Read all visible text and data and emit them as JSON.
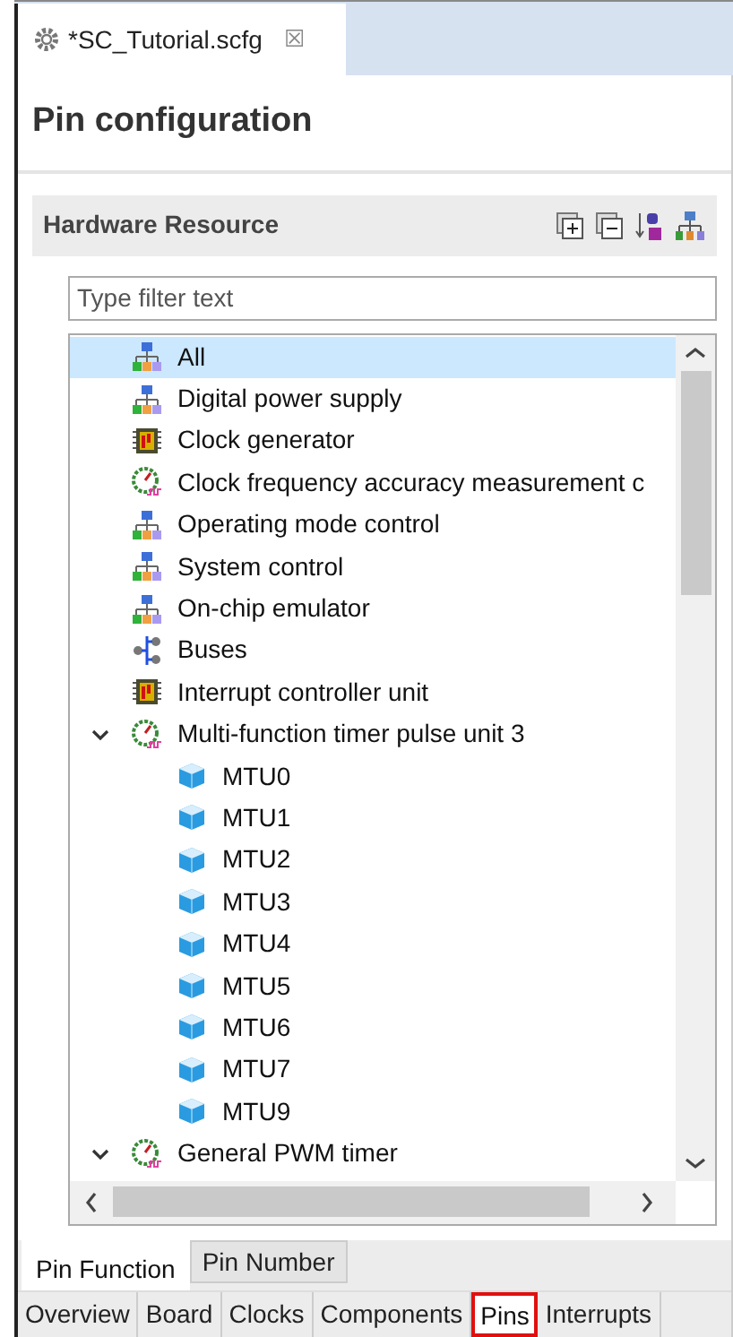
{
  "editor_tab": {
    "title": "*SC_Tutorial.scfg",
    "close": "☒"
  },
  "page_title": "Pin configuration",
  "section": {
    "title": "Hardware Resource"
  },
  "filter": {
    "placeholder": "Type filter text"
  },
  "tree": [
    {
      "label": "All",
      "kind": "network",
      "selected": true
    },
    {
      "label": "Digital power supply",
      "kind": "network",
      "selected": false
    },
    {
      "label": "Clock generator",
      "kind": "chip",
      "selected": false
    },
    {
      "label": "Clock frequency accuracy measurement c",
      "kind": "gauge",
      "selected": false
    },
    {
      "label": "Operating mode control",
      "kind": "network",
      "selected": false
    },
    {
      "label": "System control",
      "kind": "network",
      "selected": false
    },
    {
      "label": "On-chip emulator",
      "kind": "network",
      "selected": false
    },
    {
      "label": "Buses",
      "kind": "bus",
      "selected": false
    },
    {
      "label": "Interrupt controller unit",
      "kind": "chip",
      "selected": false
    },
    {
      "label": "Multi-function timer pulse unit 3",
      "kind": "gauge",
      "selected": false,
      "expanded": true,
      "children": [
        {
          "label": "MTU0",
          "kind": "cube",
          "selected": false
        },
        {
          "label": "MTU1",
          "kind": "cube",
          "selected": false
        },
        {
          "label": "MTU2",
          "kind": "cube",
          "selected": false
        },
        {
          "label": "MTU3",
          "kind": "cube",
          "selected": false
        },
        {
          "label": "MTU4",
          "kind": "cube",
          "selected": false
        },
        {
          "label": "MTU5",
          "kind": "cube",
          "selected": false
        },
        {
          "label": "MTU6",
          "kind": "cube",
          "selected": false
        },
        {
          "label": "MTU7",
          "kind": "cube",
          "selected": false
        },
        {
          "label": "MTU9",
          "kind": "cube",
          "selected": false
        }
      ]
    },
    {
      "label": "General PWM timer",
      "kind": "gauge",
      "selected": false,
      "expanded": true
    }
  ],
  "view_tabs": [
    {
      "label": "Pin Function",
      "selected": true
    },
    {
      "label": "Pin Number",
      "selected": false
    }
  ],
  "page_tabs": [
    {
      "label": "Overview",
      "selected": false
    },
    {
      "label": "Board",
      "selected": false
    },
    {
      "label": "Clocks",
      "selected": false
    },
    {
      "label": "Components",
      "selected": false
    },
    {
      "label": "Pins",
      "selected": true
    },
    {
      "label": "Interrupts",
      "selected": false
    }
  ]
}
